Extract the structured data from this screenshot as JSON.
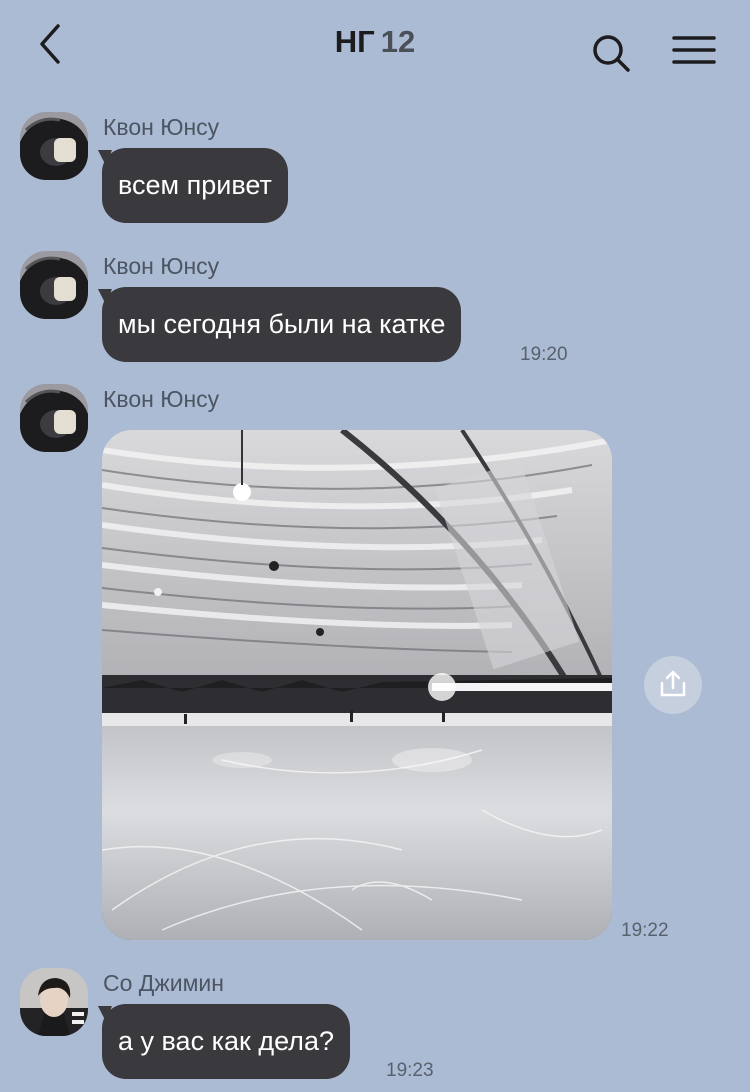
{
  "header": {
    "title": "НГ",
    "member_count": "12"
  },
  "messages": [
    {
      "sender": "Квон Юнсу",
      "text": "всем привет",
      "time": ""
    },
    {
      "sender": "Квон Юнсу",
      "text": "мы сегодня были на катке",
      "time": "19:20"
    },
    {
      "sender": "Квон Юнсу",
      "type": "image",
      "image_subject": "indoor ice rink",
      "time": "19:22"
    },
    {
      "sender": "Со Джимин",
      "text": "а у вас как дела?",
      "time": "19:23"
    }
  ],
  "icons": {
    "back": "chevron-left-icon",
    "search": "search-icon",
    "menu": "hamburger-menu-icon",
    "share": "share-icon"
  },
  "colors": {
    "background": "#abbbd4",
    "bubble": "#3a3a3e",
    "bubble_text": "#ffffff"
  }
}
